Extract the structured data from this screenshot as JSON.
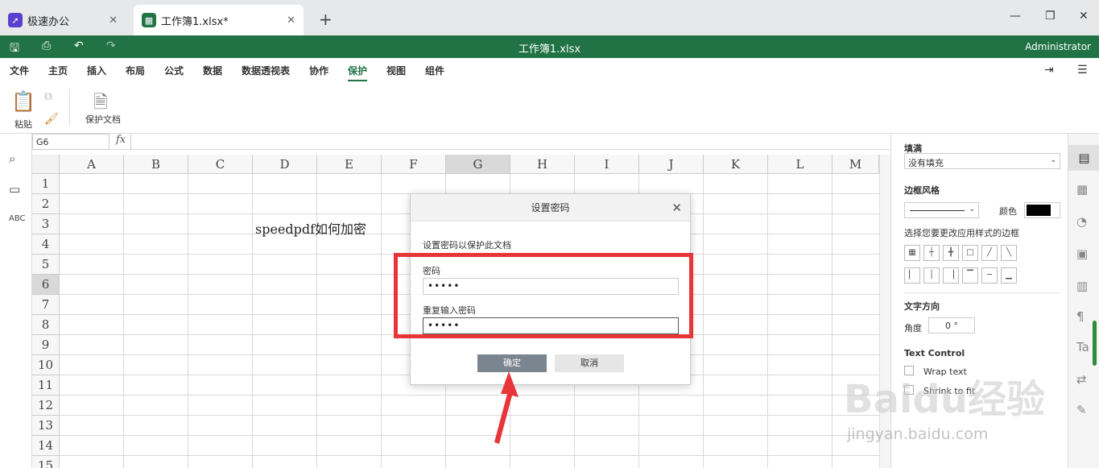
{
  "tabs": [
    {
      "label": "极速办公",
      "icon": "rocket-icon",
      "color": "#5b3fd1"
    },
    {
      "label": "工作簿1.xlsx*",
      "icon": "sheet-icon",
      "color": "#217346"
    }
  ],
  "title_bar": {
    "doc_title": "工作簿1.xlsx",
    "user": "Administrator"
  },
  "menu": [
    "文件",
    "主页",
    "插入",
    "布局",
    "公式",
    "数据",
    "数据透视表",
    "协作",
    "保护",
    "视图",
    "组件"
  ],
  "active_menu": "保护",
  "ribbon": {
    "paste": "粘贴",
    "protect_doc": "保护文档"
  },
  "formula_bar": {
    "cell_ref": "G6",
    "fx": "fx",
    "value": ""
  },
  "sheet": {
    "columns": [
      "A",
      "B",
      "C",
      "D",
      "E",
      "F",
      "G",
      "H",
      "I",
      "J",
      "K",
      "L",
      "M"
    ],
    "rows": [
      "1",
      "2",
      "3",
      "4",
      "5",
      "6",
      "7",
      "8",
      "9",
      "10",
      "11",
      "12",
      "13",
      "14",
      "15"
    ],
    "selected_col": "G",
    "selected_row": "6",
    "cell_d3": "speedpdf如何加密"
  },
  "right_panel": {
    "fill_label": "填满",
    "fill_value": "没有填充",
    "border_style_label": "边框风格",
    "color_label": "颜色",
    "border_hint": "选择您要更改应用样式的边框",
    "text_direction": "文字方向",
    "angle_label": "角度",
    "angle_value": "0 °",
    "text_control": "Text Control",
    "wrap_text": "Wrap text",
    "shrink_to_fit": "Shrink to fit"
  },
  "dialog": {
    "title": "设置密码",
    "description": "设置密码以保护此文档",
    "password_label": "密码",
    "password_value": "•••••",
    "repeat_label": "重复输入密码",
    "repeat_value": "•••••",
    "ok": "确定",
    "cancel": "取消"
  },
  "watermark": {
    "brand": "Baidu经验",
    "url": "jingyan.baidu.com"
  },
  "colors": {
    "accent": "#217346",
    "highlight": "#e8353a"
  }
}
